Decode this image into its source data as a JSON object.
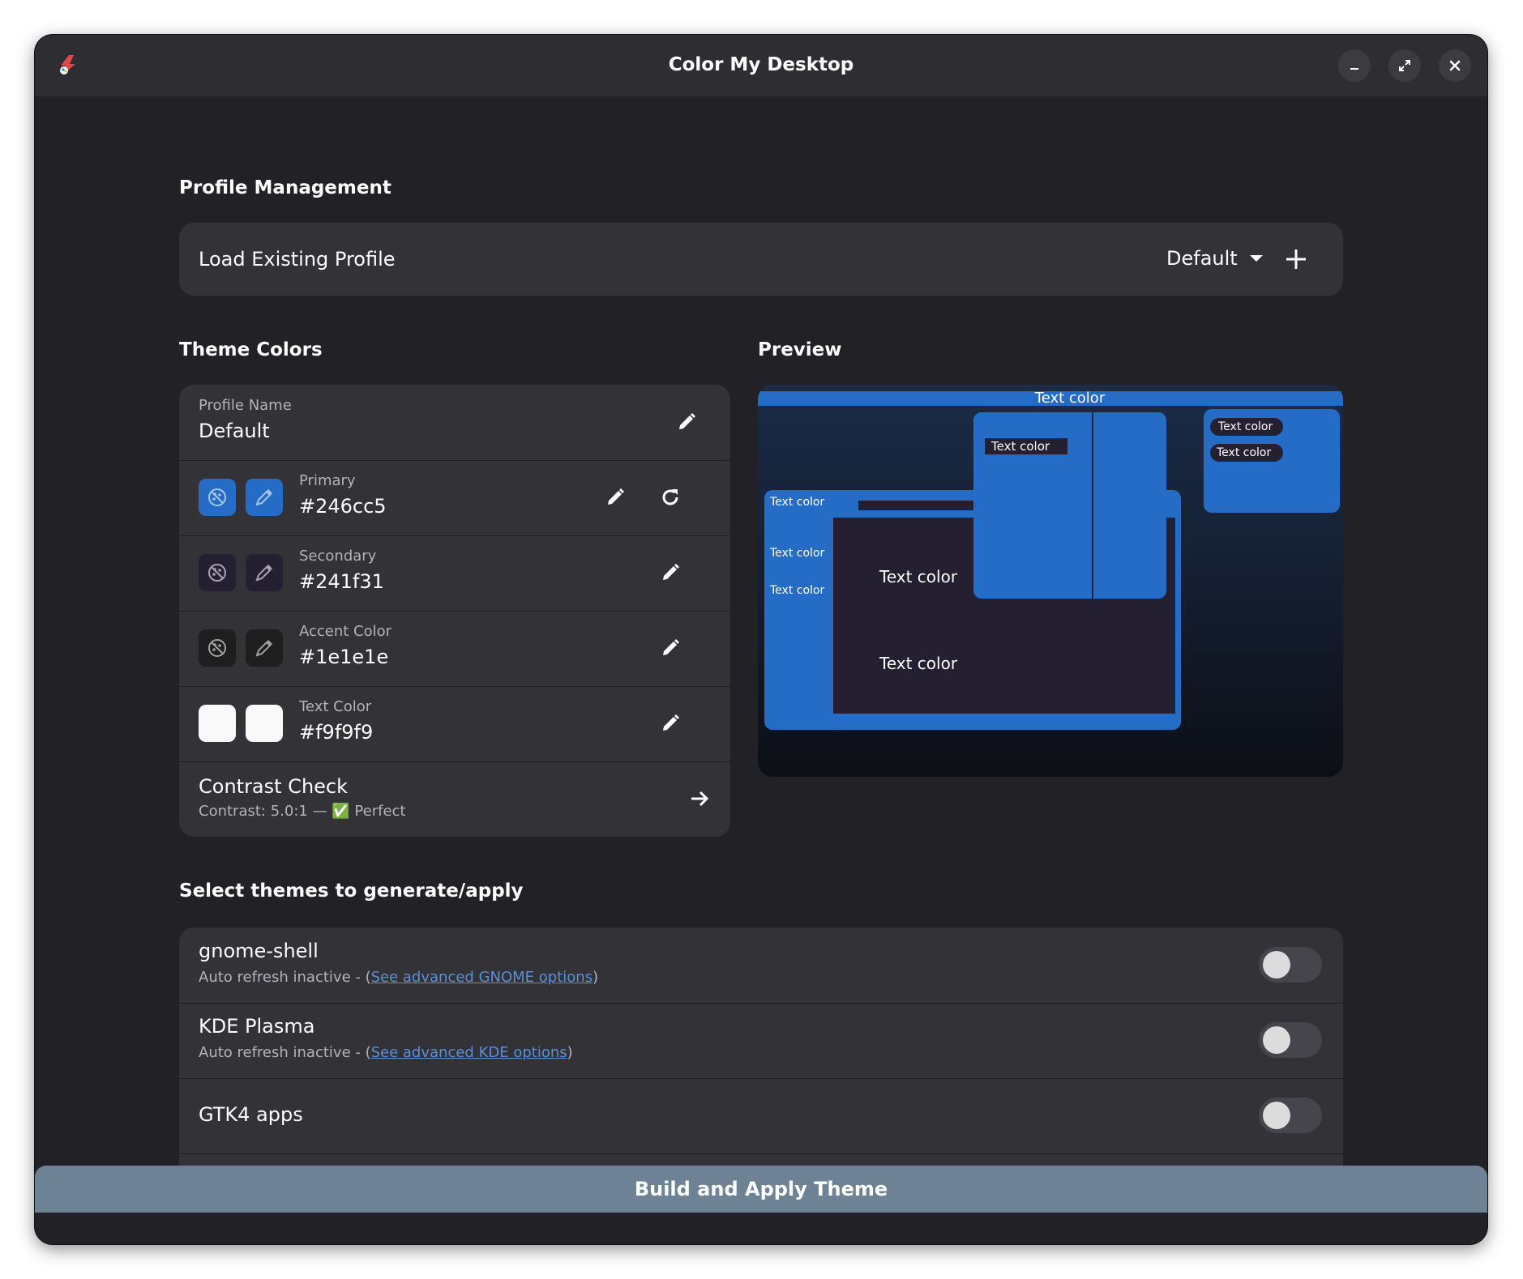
{
  "window": {
    "title": "Color My Desktop",
    "icons": {
      "app": "palette-app-icon",
      "minimize": "minimize-icon",
      "maximize": "maximize-icon",
      "close": "close-icon"
    }
  },
  "profile_management": {
    "heading": "Profile Management",
    "load_label": "Load Existing Profile",
    "selected_profile": "Default",
    "add_icon": "plus-icon"
  },
  "theme_colors": {
    "heading": "Theme Colors",
    "profile_name": {
      "label": "Profile Name",
      "value": "Default"
    },
    "colors": [
      {
        "label": "Primary",
        "value": "#246cc5"
      },
      {
        "label": "Secondary",
        "value": "#241f31"
      },
      {
        "label": "Accent Color",
        "value": "#1e1e1e"
      },
      {
        "label": "Text Color",
        "value": "#f9f9f9"
      }
    ],
    "contrast": {
      "title": "Contrast Check",
      "detail": "Contrast: 5.0:1 — ✅ Perfect"
    }
  },
  "preview": {
    "heading": "Preview",
    "top_bar_text": "Text color",
    "popup_text": "Text color",
    "pill_1": "Text color",
    "pill_2": "Text color",
    "sidebar_1": "Text color",
    "sidebar_2": "Text color",
    "sidebar_3": "Text color",
    "content_1": "Text color",
    "content_2": "Text color"
  },
  "select_themes": {
    "heading": "Select themes to generate/apply",
    "items": [
      {
        "title": "gnome-shell",
        "sub_prefix": "Auto refresh inactive - (",
        "link": "See advanced GNOME options",
        "sub_suffix": ")",
        "enabled": false
      },
      {
        "title": "KDE Plasma",
        "sub_prefix": "Auto refresh inactive - (",
        "link": "See advanced KDE options",
        "sub_suffix": ")",
        "enabled": false
      },
      {
        "title": "GTK4 apps",
        "enabled": false
      }
    ]
  },
  "apply_button": "Build and Apply Theme",
  "colors": {
    "primary": "#246cc5",
    "secondary": "#241f31",
    "accent": "#1e1e1e",
    "text": "#f9f9f9",
    "button": "#6e8296",
    "link": "#5b8fd6"
  }
}
